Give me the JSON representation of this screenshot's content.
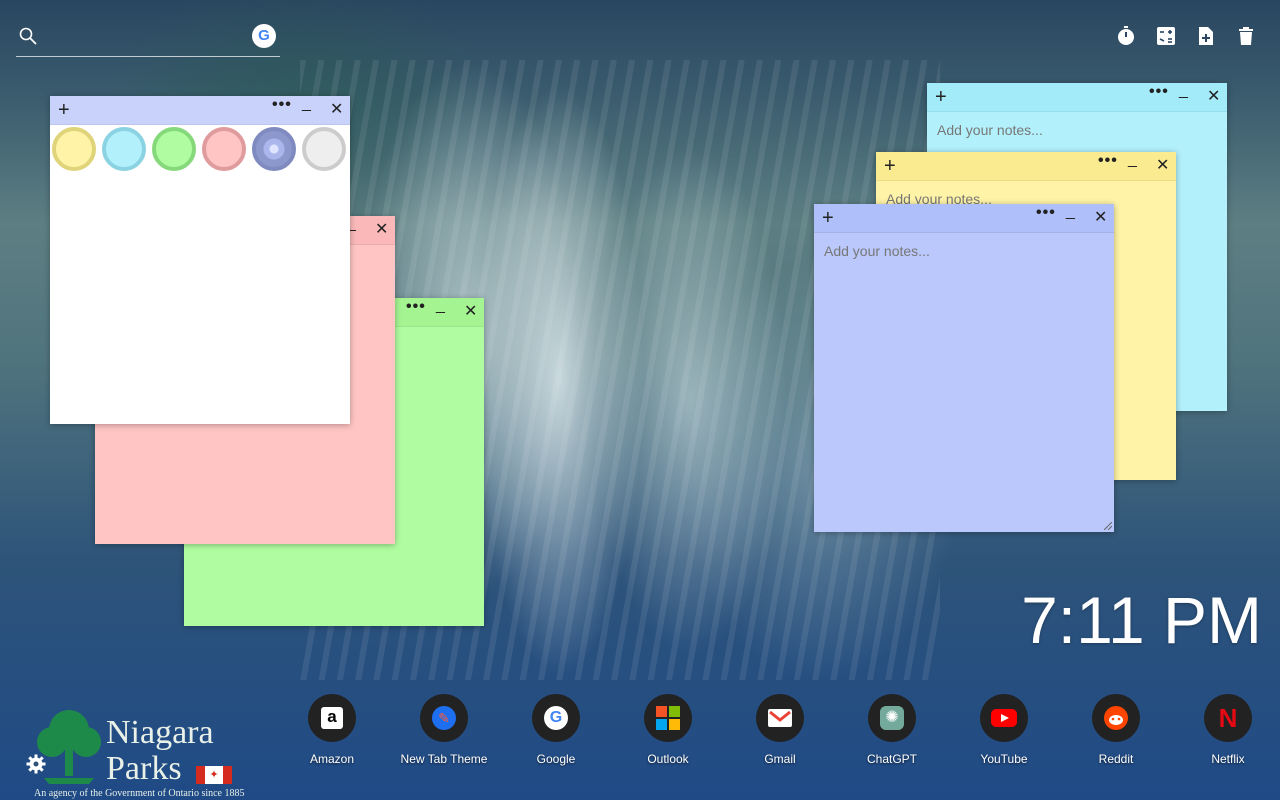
{
  "search": {
    "placeholder": "",
    "engine_letter": "G"
  },
  "top_icons": [
    "timer-icon",
    "calculator-icon",
    "new-note-icon",
    "trash-icon"
  ],
  "notes": {
    "white": {
      "colors": [
        "yellow",
        "light-blue",
        "green",
        "pink",
        "lavender",
        "light-gray"
      ]
    },
    "cyan": {
      "placeholder": "Add your notes..."
    },
    "yellow": {
      "placeholder": "Add your notes..."
    },
    "lavender": {
      "placeholder": "Add your notes..."
    }
  },
  "clock": {
    "time": "7:11 PM"
  },
  "shortcuts": [
    {
      "label": "Amazon",
      "icon": "amazon-icon"
    },
    {
      "label": "New Tab Theme",
      "icon": "new-tab-theme-icon"
    },
    {
      "label": "Google",
      "icon": "google-icon"
    },
    {
      "label": "Outlook",
      "icon": "outlook-icon"
    },
    {
      "label": "Gmail",
      "icon": "gmail-icon"
    },
    {
      "label": "ChatGPT",
      "icon": "chatgpt-icon"
    },
    {
      "label": "YouTube",
      "icon": "youtube-icon"
    },
    {
      "label": "Reddit",
      "icon": "reddit-icon"
    },
    {
      "label": "Netflix",
      "icon": "netflix-icon"
    }
  ],
  "logo": {
    "line1": "Niagara",
    "line2": "Parks",
    "tagline": "An agency of the Government of Ontario since 1885"
  },
  "colors": {
    "note_white": "#ffffff",
    "note_pink": "#ffc4c4",
    "note_green": "#b0fca0",
    "note_cyan": "#b2f0fb",
    "note_yellow": "#fef3a6",
    "note_lavender": "#bac8fc",
    "bar_white": "#c9d2fb",
    "bar_pink": "#fab8b8",
    "bar_green": "#a4f592",
    "bar_cyan": "#a4ebfa",
    "bar_yellow": "#fbeb90",
    "bar_lavender": "#aebff9"
  }
}
